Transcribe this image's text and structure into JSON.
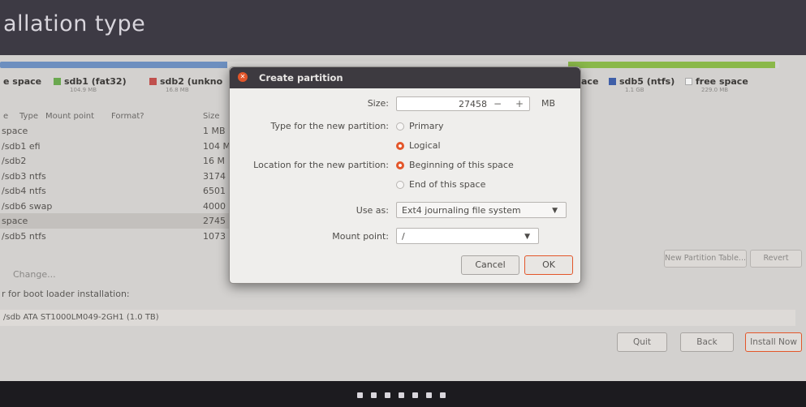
{
  "header": {
    "title": "allation type"
  },
  "legend": [
    {
      "label": "e space",
      "color": "#dedcd9",
      "sub": ""
    },
    {
      "label": "sdb1 (fat32)",
      "color": "#6aa84f",
      "sub": "104.9 MB"
    },
    {
      "label": "sdb2 (unkno",
      "color": "#c0504d",
      "sub": "16.8 MB"
    }
  ],
  "legend_right": [
    {
      "label": "ace",
      "color": "",
      "sub": ""
    },
    {
      "label": "sdb5 (ntfs)",
      "color": "#3f5fa8",
      "sub": "1.1 GB"
    },
    {
      "label": "free space",
      "color": "#f2f2f2",
      "sub": "229.0 MB"
    }
  ],
  "table": {
    "headers": [
      "e",
      "Type",
      "Mount point",
      "Format?",
      "Size"
    ],
    "rows": [
      {
        "device": "space",
        "size": "1 MB",
        "selected": false
      },
      {
        "device": "/sdb1 efi",
        "size": "104 M",
        "selected": false
      },
      {
        "device": "/sdb2",
        "size": "16 M",
        "selected": false
      },
      {
        "device": "/sdb3 ntfs",
        "size": "3174",
        "selected": false
      },
      {
        "device": "/sdb4 ntfs",
        "size": "6501",
        "selected": false
      },
      {
        "device": "/sdb6 swap",
        "size": "4000",
        "selected": false
      },
      {
        "device": "space",
        "size": "2745",
        "selected": true
      },
      {
        "device": "/sdb5 ntfs",
        "size": "1073",
        "selected": false
      }
    ]
  },
  "change_label": "Change...",
  "bootloader_label": "r for boot loader installation:",
  "bootloader_device": "/sdb   ATA ST1000LM049-2GH1 (1.0 TB)",
  "new_table_label": "New Partition Table...",
  "revert_label": "Revert",
  "nav": {
    "quit": "Quit",
    "back": "Back",
    "install": "Install Now"
  },
  "dialog": {
    "title": "Create partition",
    "size_label": "Size:",
    "size_value": "27458",
    "minus": "−",
    "plus": "+",
    "unit": "MB",
    "type_label": "Type for the new partition:",
    "primary": "Primary",
    "logical": "Logical",
    "location_label": "Location for the new partition:",
    "beginning": "Beginning of this space",
    "end": "End of this space",
    "use_as_label": "Use as:",
    "use_as_value": "Ext4 journaling file system",
    "mount_label": "Mount point:",
    "mount_value": "/",
    "cancel": "Cancel",
    "ok": "OK"
  },
  "steps_total": 7
}
